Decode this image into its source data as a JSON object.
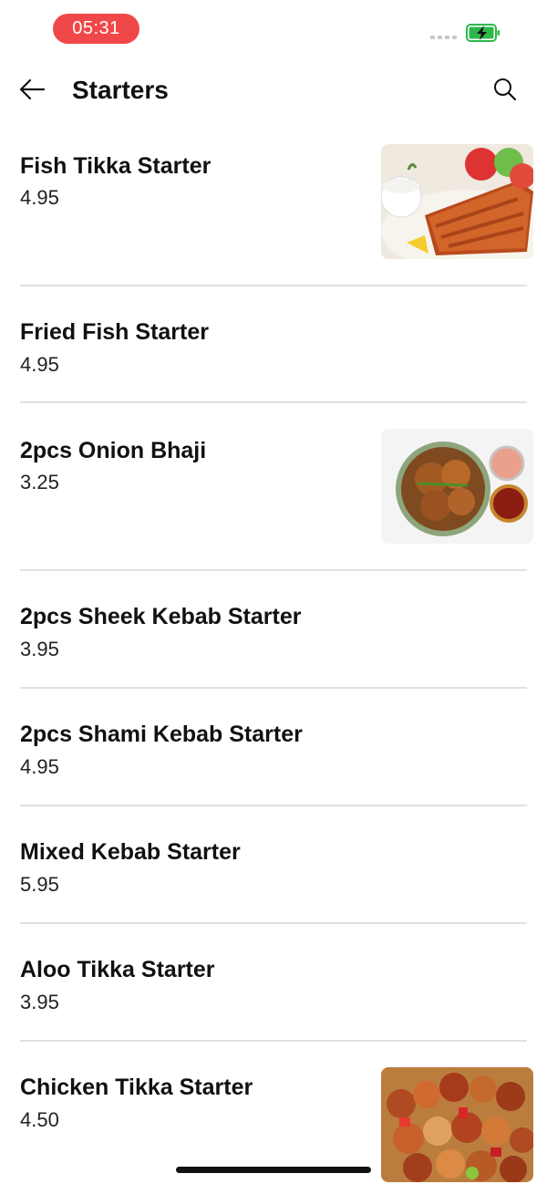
{
  "status_bar": {
    "time": "05:31"
  },
  "header": {
    "title": "Starters"
  },
  "items": [
    {
      "name": "Fish Tikka Starter",
      "price": "4.95"
    },
    {
      "name": "Fried Fish Starter",
      "price": "4.95"
    },
    {
      "name": "2pcs Onion Bhaji",
      "price": "3.25"
    },
    {
      "name": "2pcs Sheek Kebab Starter",
      "price": "3.95"
    },
    {
      "name": "2pcs Shami Kebab Starter",
      "price": "4.95"
    },
    {
      "name": "Mixed Kebab Starter",
      "price": "5.95"
    },
    {
      "name": "Aloo Tikka Starter",
      "price": "3.95"
    },
    {
      "name": "Chicken Tikka Starter",
      "price": "4.50"
    }
  ],
  "colors": {
    "time_pill": "#f04848",
    "battery": "#2fb84a"
  }
}
